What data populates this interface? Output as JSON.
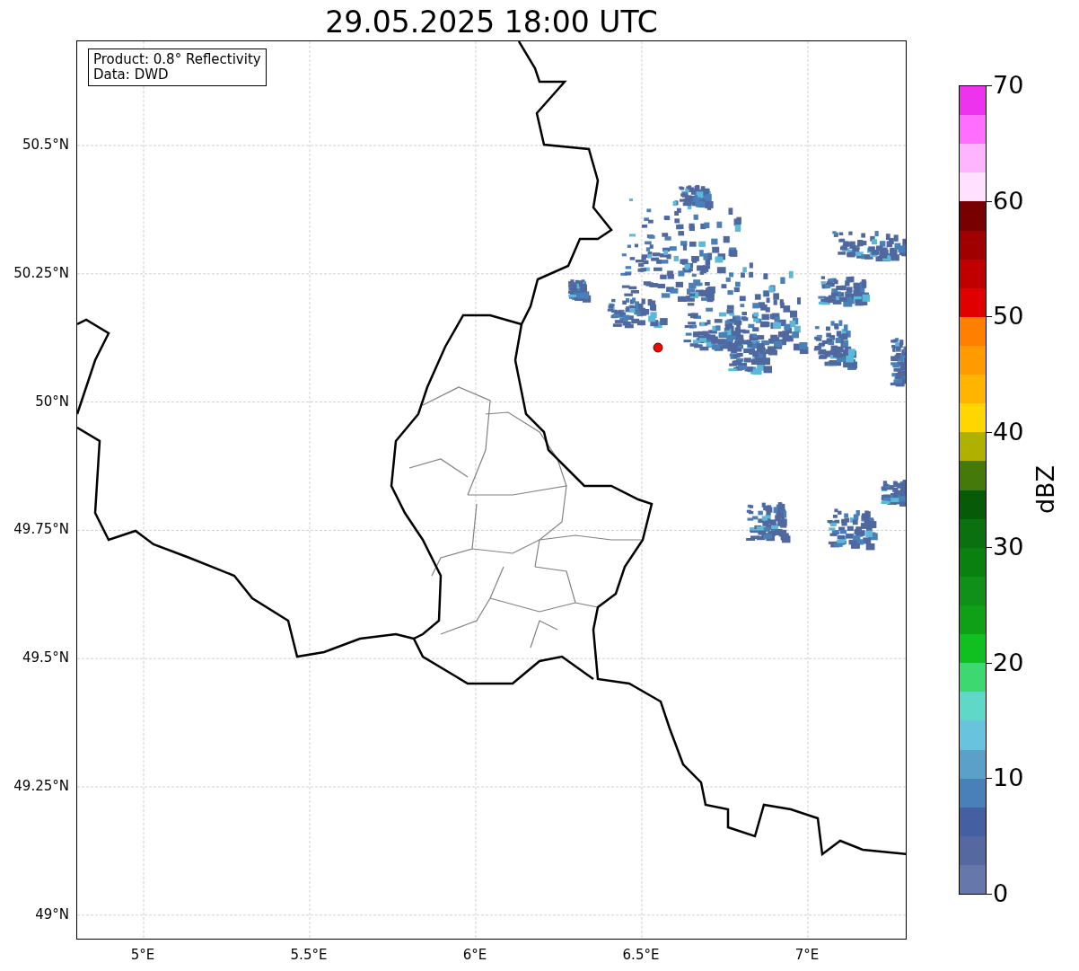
{
  "title": "29.05.2025 18:00 UTC",
  "info_box": [
    "Product: 0.8° Reflectivity",
    "Data: DWD"
  ],
  "map": {
    "xticks": [
      "5°E",
      "5.5°E",
      "6°E",
      "6.5°E",
      "7°E"
    ],
    "yticks": [
      "50.5°N",
      "50.25°N",
      "50°N",
      "49.75°N",
      "49.5°N",
      "49.25°N",
      "49°N"
    ],
    "marker": {
      "color": "#ff0000"
    }
  },
  "colorbar": {
    "label": "dBZ",
    "ticks": [
      "70",
      "60",
      "50",
      "40",
      "30",
      "20",
      "10",
      "0"
    ],
    "segments": [
      {
        "color": "#ee33ee"
      },
      {
        "color": "#ff6eff"
      },
      {
        "color": "#ffb4ff"
      },
      {
        "color": "#ffe0ff"
      },
      {
        "color": "#780000"
      },
      {
        "color": "#a00000"
      },
      {
        "color": "#c00000"
      },
      {
        "color": "#e00000"
      },
      {
        "color": "#ff8000"
      },
      {
        "color": "#ff9a00"
      },
      {
        "color": "#ffb400"
      },
      {
        "color": "#ffd700"
      },
      {
        "color": "#b0b000"
      },
      {
        "color": "#457a0a"
      },
      {
        "color": "#065a08"
      },
      {
        "color": "#0a7010"
      },
      {
        "color": "#0a8010"
      },
      {
        "color": "#109018"
      },
      {
        "color": "#10a018"
      },
      {
        "color": "#10c020"
      },
      {
        "color": "#3dd870"
      },
      {
        "color": "#60d8c8"
      },
      {
        "color": "#68c4dc"
      },
      {
        "color": "#5aa0c8"
      },
      {
        "color": "#4a80b8"
      },
      {
        "color": "#4460a0"
      },
      {
        "color": "#5569a0"
      },
      {
        "color": "#6677aa"
      }
    ]
  }
}
